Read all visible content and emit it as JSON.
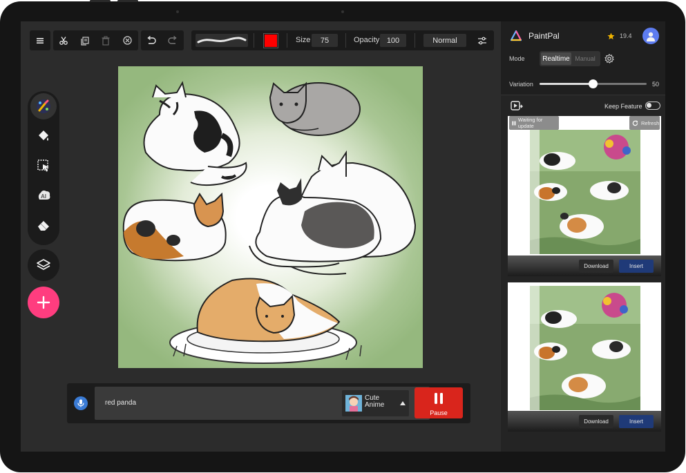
{
  "toolbar": {
    "size_label": "Size",
    "size_value": "75",
    "opacity_label": "Opacity",
    "opacity_value": "100",
    "blend_mode": "Normal",
    "brush_color": "#ff0000",
    "icons": [
      "menu-icon",
      "scissors-icon",
      "copy-icon",
      "trash-icon",
      "transform-icon",
      "undo-icon",
      "redo-icon",
      "brush-stroke-icon",
      "sliders-icon"
    ]
  },
  "left_tools": {
    "icons": [
      "paint-brush-tool-icon",
      "fill-bucket-icon",
      "select-move-icon",
      "ai-tool-icon",
      "eraser-icon",
      "layers-icon",
      "add-icon"
    ],
    "add_color": "#ff3d7f"
  },
  "prompt": {
    "text": "red panda",
    "style_line1": "Cute",
    "style_line2": "Anime",
    "pause_label": "Pause",
    "pause_color": "#d9251c"
  },
  "panel": {
    "app_name": "PaintPal",
    "credits": "19.4",
    "mode_label": "Mode",
    "mode_realtime": "Realtime",
    "mode_manual": "Manual",
    "variation_label": "Variation",
    "variation_value": "50",
    "variation_fraction": 0.5,
    "keep_feature_label": "Keep Feature",
    "keep_feature_on": false,
    "results": [
      {
        "status": "Waiting for update",
        "refresh": "Refresh",
        "download": "Download",
        "insert": "Insert"
      },
      {
        "download": "Download",
        "insert": "Insert"
      }
    ],
    "insert_color": "#1f3a78"
  }
}
